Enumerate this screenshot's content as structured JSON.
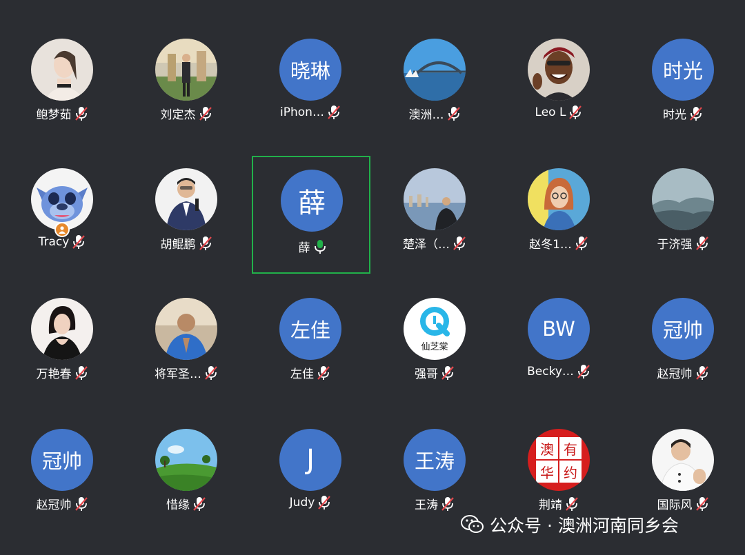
{
  "participants": [
    {
      "name": "鲍梦茹",
      "mic": "muted",
      "avatar": {
        "type": "photo",
        "icon": "woman-portrait"
      }
    },
    {
      "name": "刘定杰",
      "mic": "muted",
      "avatar": {
        "type": "photo",
        "icon": "man-standing-portrait"
      }
    },
    {
      "name": "iPhon…",
      "mic": "muted",
      "avatar": {
        "type": "text",
        "text": "晓琳"
      }
    },
    {
      "name": "澳洲…",
      "mic": "muted",
      "avatar": {
        "type": "photo",
        "icon": "sydney-harbour-bridge"
      }
    },
    {
      "name": "Leo L",
      "mic": "muted",
      "avatar": {
        "type": "photo",
        "icon": "smiling-man-portrait"
      }
    },
    {
      "name": "时光",
      "mic": "muted",
      "avatar": {
        "type": "text",
        "text": "时光"
      }
    },
    {
      "name": "Tracy",
      "mic": "muted",
      "host": true,
      "avatar": {
        "type": "photo",
        "icon": "cartoon-blue-character"
      }
    },
    {
      "name": "胡鲲鹏",
      "mic": "muted",
      "avatar": {
        "type": "photo",
        "icon": "man-suit-portrait"
      }
    },
    {
      "name": "薛",
      "mic": "speaking",
      "active": true,
      "avatar": {
        "type": "text",
        "text": "薛",
        "big": true
      }
    },
    {
      "name": "楚泽（…",
      "mic": "muted",
      "avatar": {
        "type": "photo",
        "icon": "seaside-person"
      }
    },
    {
      "name": "赵冬1…",
      "mic": "muted",
      "avatar": {
        "type": "photo",
        "icon": "woman-glasses-portrait"
      }
    },
    {
      "name": "于济强",
      "mic": "muted",
      "avatar": {
        "type": "photo",
        "icon": "misty-mountains"
      }
    },
    {
      "name": "万艳春",
      "mic": "muted",
      "avatar": {
        "type": "photo",
        "icon": "woman-black-portrait"
      }
    },
    {
      "name": "将军圣…",
      "mic": "muted",
      "avatar": {
        "type": "photo",
        "icon": "man-praying-portrait"
      }
    },
    {
      "name": "左佳",
      "mic": "muted",
      "avatar": {
        "type": "text",
        "text": "左佳"
      }
    },
    {
      "name": "强哥",
      "mic": "muted",
      "avatar": {
        "type": "logo",
        "text": "仙芝棠",
        "icon": "q-logo"
      }
    },
    {
      "name": "Becky…",
      "mic": "muted",
      "avatar": {
        "type": "text",
        "text": "BW"
      }
    },
    {
      "name": "赵冠帅",
      "mic": "muted",
      "avatar": {
        "type": "text",
        "text": "冠帅"
      }
    },
    {
      "name": "赵冠帅",
      "mic": "muted",
      "avatar": {
        "type": "text",
        "text": "冠帅"
      }
    },
    {
      "name": "惜缘",
      "mic": "muted",
      "avatar": {
        "type": "photo",
        "icon": "green-landscape"
      }
    },
    {
      "name": "Judy",
      "mic": "muted",
      "avatar": {
        "type": "text",
        "text": "J",
        "big": true
      }
    },
    {
      "name": "王涛",
      "mic": "muted",
      "avatar": {
        "type": "text",
        "text": "王涛"
      }
    },
    {
      "name": "荆靖",
      "mic": "muted",
      "avatar": {
        "type": "seal",
        "text": "澳华有约",
        "icon": "red-seal"
      }
    },
    {
      "name": "国际风",
      "mic": "muted",
      "avatar": {
        "type": "photo",
        "icon": "chef-portrait"
      }
    }
  ],
  "watermark": {
    "text": "公众号 · 澳洲河南同乡会",
    "icon": "wechat-icon"
  },
  "colors": {
    "background": "#2b2d32",
    "avatar_blue": "#4275c9",
    "speaking_border": "#21b14a",
    "mic_active": "#21b14a",
    "mic_muted_slash": "#e5484d"
  }
}
